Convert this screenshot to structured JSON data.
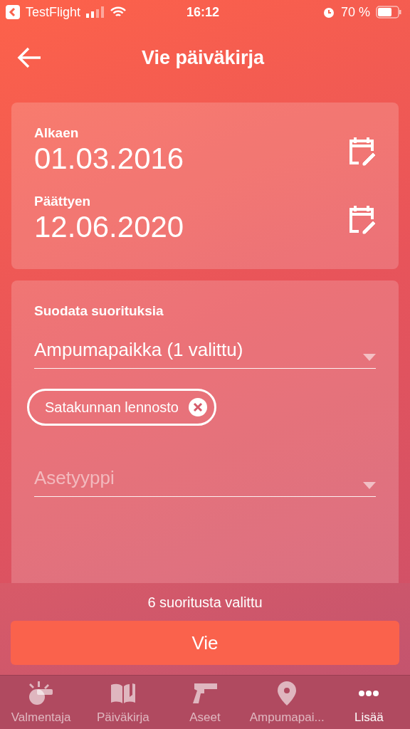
{
  "status_bar": {
    "back_app": "TestFlight",
    "time": "16:12",
    "battery": "70 %"
  },
  "header": {
    "title": "Vie päiväkirja"
  },
  "date_range": [
    {
      "label": "Alkaen",
      "value": "01.03.2016"
    },
    {
      "label": "Päättyen",
      "value": "12.06.2020"
    }
  ],
  "filter": {
    "title": "Suodata suorituksia",
    "fields": [
      {
        "value": "Ampumapaikka (1 valittu)",
        "chips": [
          "Satakunnan lennosto"
        ]
      },
      {
        "placeholder": "Asetyyppi"
      }
    ]
  },
  "summary": "6 suoritusta valittu",
  "export_button": "Vie",
  "tabs": [
    {
      "label": "Valmentaja",
      "kind": "whistle",
      "selected": false
    },
    {
      "label": "Päiväkirja",
      "kind": "book",
      "selected": false
    },
    {
      "label": "Aseet",
      "kind": "pistol",
      "selected": false
    },
    {
      "label": "Ampumapai...",
      "kind": "pin",
      "selected": false
    },
    {
      "label": "Lisää",
      "kind": "more",
      "selected": true
    }
  ]
}
